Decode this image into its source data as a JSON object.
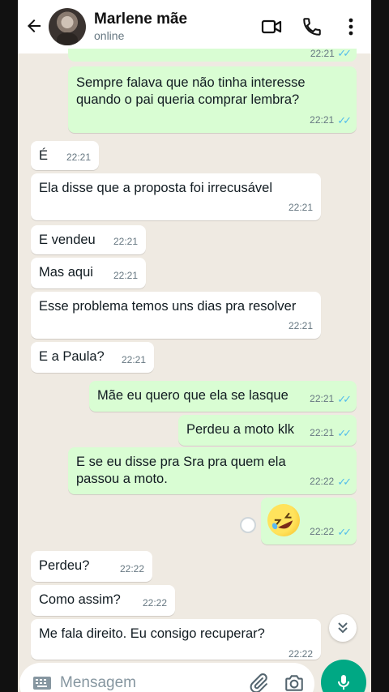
{
  "header": {
    "contact_name": "Marlene mãe",
    "status": "online"
  },
  "colors": {
    "incoming": "#ffffff",
    "outgoing": "#d9fdd3",
    "accent": "#00a884",
    "read_ticks": "#53bdeb"
  },
  "messages": [
    {
      "dir": "out",
      "text": "",
      "time": "22:21",
      "partial": true
    },
    {
      "dir": "out",
      "text": "Sempre falava que não tinha interesse quando o pai queria comprar lembra?",
      "time": "22:21"
    },
    {
      "dir": "in",
      "text": "É",
      "time": "22:21"
    },
    {
      "dir": "in",
      "text": "Ela disse que a proposta foi irrecusável",
      "time": "22:21"
    },
    {
      "dir": "in",
      "text": "E vendeu",
      "time": "22:21"
    },
    {
      "dir": "in",
      "text": "Mas aqui",
      "time": "22:21"
    },
    {
      "dir": "in",
      "text": "Esse problema temos uns dias pra resolver",
      "time": "22:21"
    },
    {
      "dir": "in",
      "text": "E a Paula?",
      "time": "22:21"
    },
    {
      "dir": "out",
      "text": "Mãe eu quero que ela se lasque",
      "time": "22:21"
    },
    {
      "dir": "out",
      "text": "Perdeu a moto klk",
      "time": "22:21"
    },
    {
      "dir": "out",
      "text": "E se eu disse pra Sra pra quem ela passou a moto.",
      "time": "22:22"
    },
    {
      "dir": "out",
      "text": "",
      "time": "22:22",
      "emoji": "rolling-on-floor-laughing"
    },
    {
      "dir": "in",
      "text": "Perdeu?",
      "time": "22:22"
    },
    {
      "dir": "in",
      "text": "Como assim?",
      "time": "22:22"
    },
    {
      "dir": "in",
      "text": "Me fala direito. Eu consigo recuperar?",
      "time": "22:22"
    }
  ],
  "composer": {
    "placeholder": "Mensagem"
  },
  "icons": [
    "back-arrow-icon",
    "video-call-icon",
    "phone-icon",
    "more-vert-icon",
    "keyboard-icon",
    "attach-icon",
    "camera-icon",
    "mic-icon",
    "chevron-double-down-icon"
  ]
}
